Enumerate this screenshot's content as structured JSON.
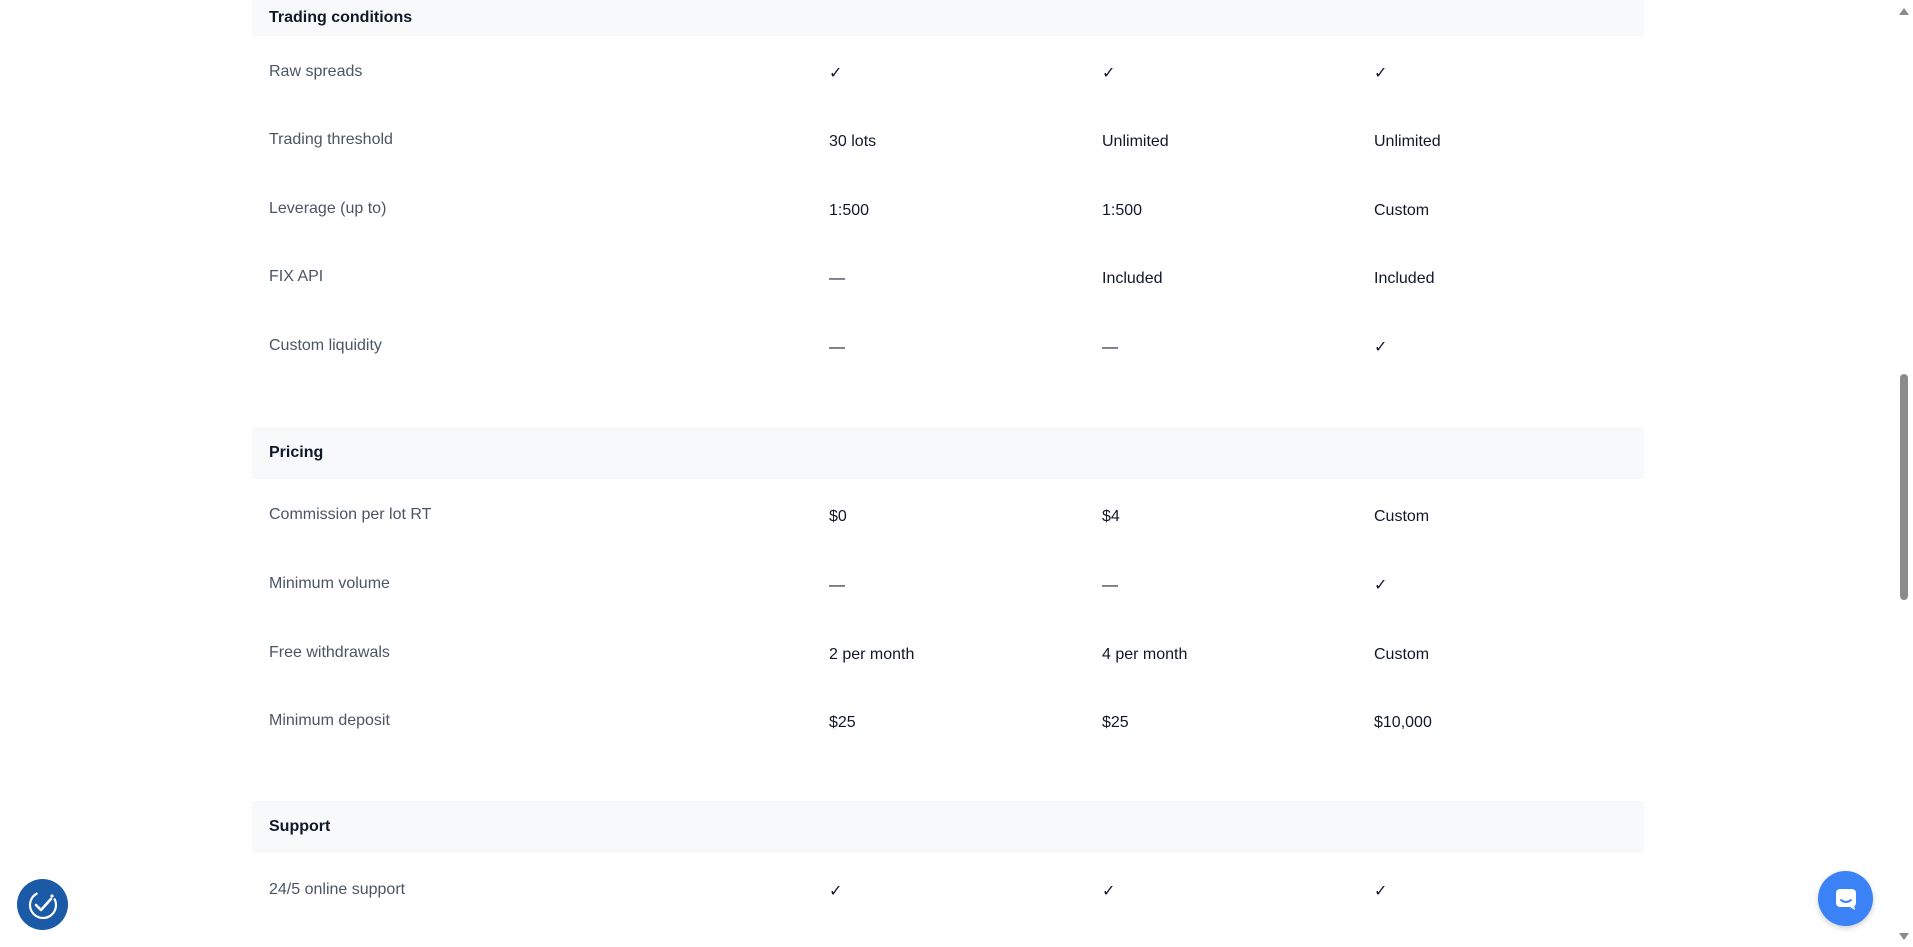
{
  "sections": [
    {
      "title": "Trading conditions",
      "rows": [
        {
          "label": "Raw spreads",
          "values": [
            "✓",
            "✓",
            "✓"
          ]
        },
        {
          "label": "Trading threshold",
          "values": [
            "30 lots",
            "Unlimited",
            "Unlimited"
          ]
        },
        {
          "label": "Leverage (up to)",
          "values": [
            "1:500",
            "1:500",
            "Custom"
          ]
        },
        {
          "label": "FIX API",
          "values": [
            "—",
            "Included",
            "Included"
          ]
        },
        {
          "label": "Custom liquidity",
          "values": [
            "—",
            "—",
            "✓"
          ]
        }
      ]
    },
    {
      "title": "Pricing",
      "rows": [
        {
          "label": "Commission per lot RT",
          "values": [
            "$0",
            "$4",
            "Custom"
          ]
        },
        {
          "label": "Minimum volume",
          "values": [
            "—",
            "—",
            "✓"
          ]
        },
        {
          "label": "Free withdrawals",
          "values": [
            "2 per month",
            "4 per month",
            "Custom"
          ]
        },
        {
          "label": "Minimum deposit",
          "values": [
            "$25",
            "$25",
            "$10,000"
          ]
        }
      ]
    },
    {
      "title": "Support",
      "rows": [
        {
          "label": "24/5 online support",
          "values": [
            "✓",
            "✓",
            "✓"
          ]
        }
      ]
    }
  ],
  "icons": {
    "check": "check-icon",
    "dash": "dash-icon",
    "cookie": "cookie-consent-icon",
    "chat": "chat-icon"
  },
  "colors": {
    "check": "#0f9d6b",
    "dash": "#9ca3af",
    "section_bg": "#f8f9fb",
    "cookie_widget": "#1a5aa6",
    "chat_widget": "#3b82f6"
  }
}
